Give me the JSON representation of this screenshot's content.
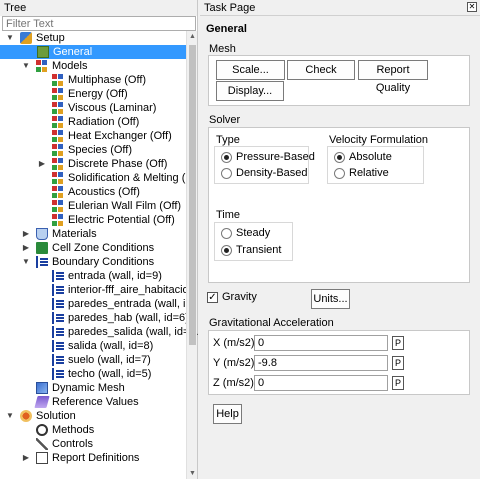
{
  "tree": {
    "header": "Tree",
    "filter_placeholder": "Filter Text",
    "items": [
      {
        "label": "Setup"
      },
      {
        "label": "General"
      },
      {
        "label": "Models"
      },
      {
        "label": "Multiphase (Off)"
      },
      {
        "label": "Energy (Off)"
      },
      {
        "label": "Viscous (Laminar)"
      },
      {
        "label": "Radiation (Off)"
      },
      {
        "label": "Heat Exchanger (Off)"
      },
      {
        "label": "Species (Off)"
      },
      {
        "label": "Discrete Phase (Off)"
      },
      {
        "label": "Solidification & Melting (..."
      },
      {
        "label": "Acoustics (Off)"
      },
      {
        "label": "Eulerian Wall Film (Off)"
      },
      {
        "label": "Electric Potential (Off)"
      },
      {
        "label": "Materials"
      },
      {
        "label": "Cell Zone Conditions"
      },
      {
        "label": "Boundary Conditions"
      },
      {
        "label": "entrada (wall, id=9)"
      },
      {
        "label": "interior-fff_aire_habitacio..."
      },
      {
        "label": "paredes_entrada (wall, i..."
      },
      {
        "label": "paredes_hab (wall, id=6)"
      },
      {
        "label": "paredes_salida (wall, id=..."
      },
      {
        "label": "salida (wall, id=8)"
      },
      {
        "label": "suelo (wall, id=7)"
      },
      {
        "label": "techo (wall, id=5)"
      },
      {
        "label": "Dynamic Mesh"
      },
      {
        "label": "Reference Values"
      },
      {
        "label": "Solution"
      },
      {
        "label": "Methods"
      },
      {
        "label": "Controls"
      },
      {
        "label": "Report Definitions"
      }
    ]
  },
  "task": {
    "header": "Task Page",
    "title": "General",
    "mesh": {
      "label": "Mesh",
      "scale": "Scale...",
      "check": "Check",
      "report_quality": "Report Quality",
      "display": "Display..."
    },
    "solver": {
      "label": "Solver",
      "type_label": "Type",
      "pressure_based": "Pressure-Based",
      "density_based": "Density-Based",
      "velocity_label": "Velocity Formulation",
      "absolute": "Absolute",
      "relative": "Relative",
      "time_label": "Time",
      "steady": "Steady",
      "transient": "Transient"
    },
    "gravity": {
      "label": "Gravity",
      "units": "Units...",
      "accel_label": "Gravitational Acceleration",
      "x_label": "X (m/s2)",
      "y_label": "Y (m/s2)",
      "z_label": "Z (m/s2)",
      "x_value": "0",
      "y_value": "-9.8",
      "z_value": "0",
      "p": "P"
    },
    "help": "Help"
  }
}
